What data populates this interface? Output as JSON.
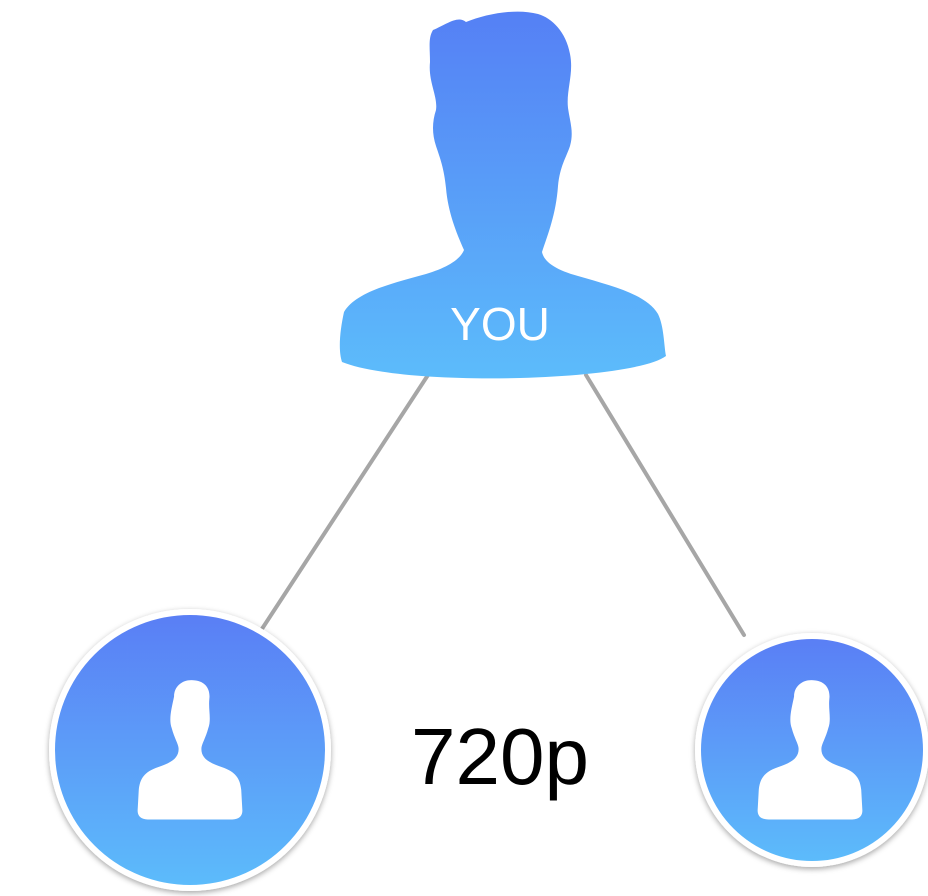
{
  "you_label": "YOU",
  "quality_label": "720p",
  "colors": {
    "gradient_top": "#5580f5",
    "gradient_bottom": "#5cbcfb",
    "connector": "#a6a6a6",
    "circle_border": "#ffffff",
    "text_dark": "#000000",
    "text_light": "#ffffff"
  },
  "icons": {
    "center": "person-silhouette-icon",
    "left": "person-avatar-icon",
    "right": "person-avatar-icon"
  }
}
